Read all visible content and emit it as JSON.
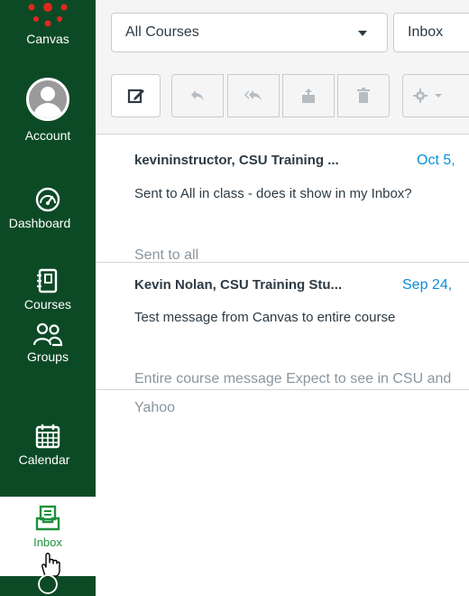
{
  "nav": {
    "items": [
      {
        "label": "Canvas",
        "icon": "canvas-logo-icon"
      },
      {
        "label": "Account",
        "icon": "avatar-icon"
      },
      {
        "label": "Dashboard",
        "icon": "dashboard-gauge-icon"
      },
      {
        "label": "Courses",
        "icon": "courses-book-icon"
      },
      {
        "label": "Groups",
        "icon": "groups-people-icon"
      },
      {
        "label": "Calendar",
        "icon": "calendar-icon"
      },
      {
        "label": "Inbox",
        "icon": "inbox-tray-icon",
        "active": true
      }
    ],
    "colors": {
      "bg": "#0c4a26",
      "active_label": "#1f8f3c",
      "logo": "#e0281f"
    }
  },
  "toolbar": {
    "course_filter": {
      "selected": "All Courses"
    },
    "mailbox_filter": {
      "selected": "Inbox"
    },
    "buttons": [
      {
        "name": "compose",
        "icon": "compose-icon"
      },
      {
        "name": "reply",
        "icon": "reply-icon"
      },
      {
        "name": "reply-all",
        "icon": "reply-all-icon"
      },
      {
        "name": "archive",
        "icon": "archive-icon"
      },
      {
        "name": "delete",
        "icon": "trash-icon"
      },
      {
        "name": "settings",
        "icon": "gear-icon"
      }
    ]
  },
  "messages": [
    {
      "sender": "kevininstructor, CSU Training ...",
      "date": "Oct 5,",
      "subject": "Sent to All in class - does it show in my Inbox?",
      "preview": "Sent to all"
    },
    {
      "sender": "Kevin Nolan, CSU Training Stu...",
      "date": "Sep 24,",
      "subject": "Test message from Canvas to entire course",
      "preview": "Entire course message Expect to see in CSU and Yahoo"
    }
  ],
  "colors": {
    "link": "#0a8fd8",
    "muted": "#8b969e",
    "text": "#2d3b45"
  }
}
